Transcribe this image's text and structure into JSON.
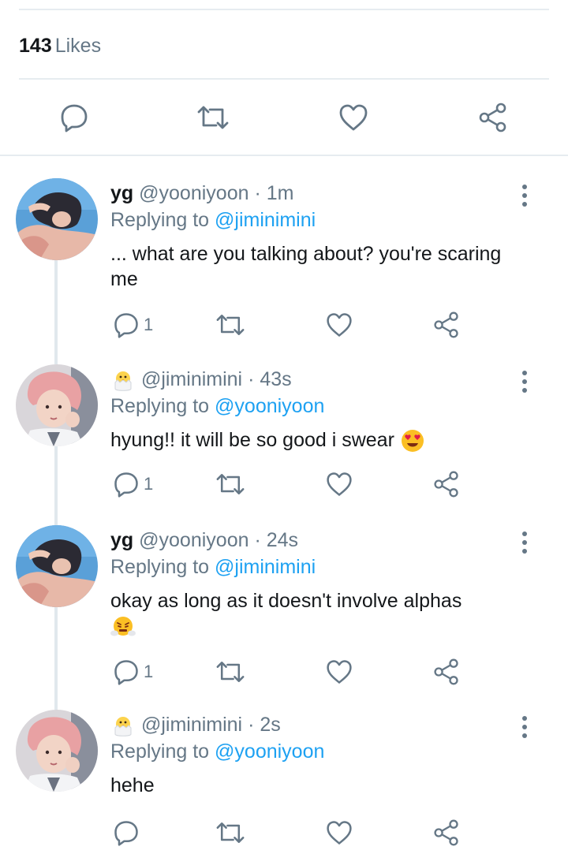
{
  "stats": {
    "likes_count": "143",
    "likes_label": "Likes"
  },
  "main_actions": [
    "reply-icon",
    "retweet-icon",
    "like-icon",
    "share-icon"
  ],
  "colors": {
    "text": "#14171a",
    "secondary": "#657786",
    "link": "#1da1f2",
    "divider": "#e6ecf0"
  },
  "replies": [
    {
      "name": "yg",
      "handle": "@yooniyoon",
      "dot": "·",
      "time": "1m",
      "replying_label": "Replying to",
      "replying_to": "@jiminimini",
      "text": "... what are you talking about? you're scaring me",
      "reply_count": "1",
      "avatar": "yg-avatar"
    },
    {
      "name_emoji": "hatching-chick-emoji",
      "handle": "@jiminimini",
      "dot": "·",
      "time": "43s",
      "replying_label": "Replying to",
      "replying_to": "@yooniyoon",
      "text": "hyung!! it will be so good i swear",
      "text_emoji": "heart-eyes-emoji",
      "reply_count": "1",
      "avatar": "jimin-avatar"
    },
    {
      "name": "yg",
      "handle": "@yooniyoon",
      "dot": "·",
      "time": "24s",
      "replying_label": "Replying to",
      "replying_to": "@jiminimini",
      "text": "okay as long as it doesn't involve alphas",
      "text_emoji": "steam-face-emoji",
      "reply_count": "1",
      "avatar": "yg-avatar"
    },
    {
      "name_emoji": "hatching-chick-emoji",
      "handle": "@jiminimini",
      "dot": "·",
      "time": "2s",
      "replying_label": "Replying to",
      "replying_to": "@yooniyoon",
      "text": "hehe",
      "reply_count": "",
      "avatar": "jimin-avatar"
    }
  ]
}
